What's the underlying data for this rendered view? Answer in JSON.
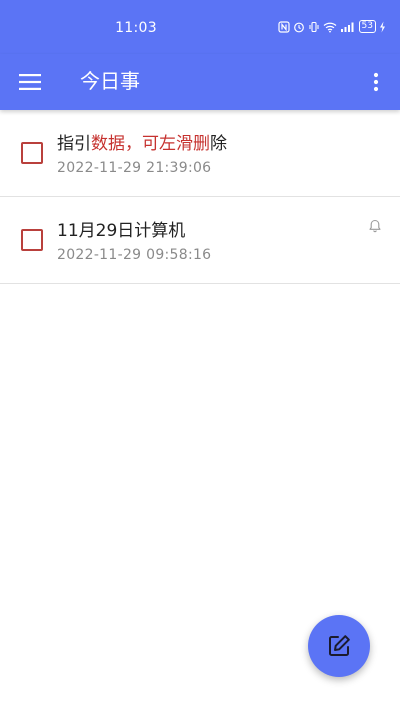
{
  "status_bar": {
    "time": "11:03",
    "battery": "53"
  },
  "app_bar": {
    "title": "今日事",
    "menu_icon": "hamburger-menu-icon",
    "more_icon": "more-vertical-icon"
  },
  "tasks": [
    {
      "title_parts": [
        "指引",
        "数据，可左滑删",
        "除"
      ],
      "date": "2022-11-29 21:39:06",
      "has_reminder": false
    },
    {
      "title": "11月29日计算机",
      "date": "2022-11-29 09:58:16",
      "has_reminder": true
    }
  ],
  "fab": {
    "icon": "edit-icon"
  },
  "colors": {
    "primary": "#5b74f5",
    "checkbox": "#b9403c",
    "highlight": "#c6322f"
  }
}
